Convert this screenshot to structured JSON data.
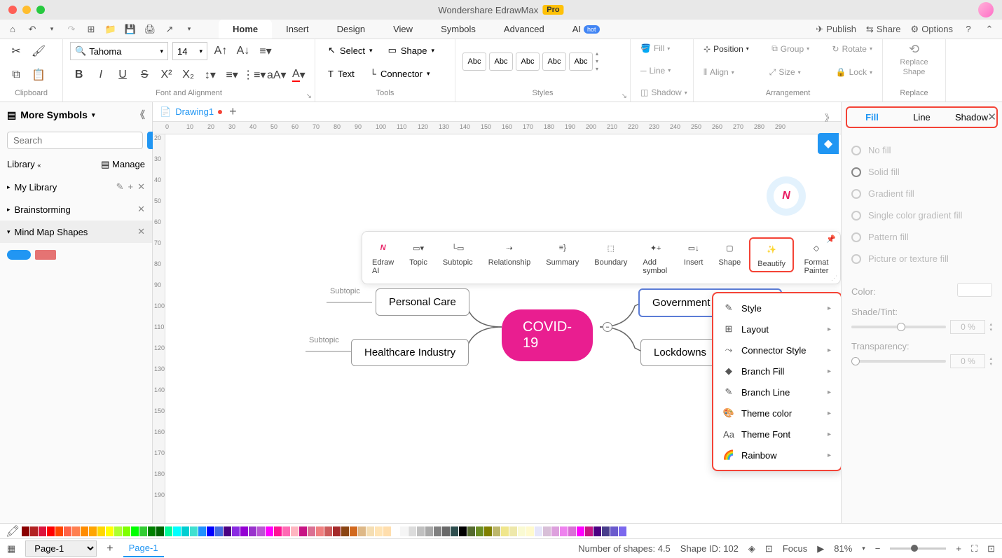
{
  "titlebar": {
    "app_name": "Wondershare EdrawMax",
    "pro": "Pro"
  },
  "menubar": {
    "tabs": [
      "Home",
      "Insert",
      "Design",
      "View",
      "Symbols",
      "Advanced"
    ],
    "ai_label": "AI",
    "hot": "hot",
    "right": {
      "publish": "Publish",
      "share": "Share",
      "options": "Options"
    }
  },
  "ribbon": {
    "clipboard": "Clipboard",
    "font": {
      "name": "Tahoma",
      "size": "14",
      "group_label": "Font and Alignment"
    },
    "tools": {
      "select": "Select",
      "shape": "Shape",
      "text": "Text",
      "connector": "Connector",
      "group_label": "Tools"
    },
    "styles": {
      "swatch_label": "Abc",
      "group_label": "Styles"
    },
    "style_dropdowns": {
      "fill": "Fill",
      "line": "Line",
      "shadow": "Shadow"
    },
    "arrangement": {
      "position": "Position",
      "align": "Align",
      "group": "Group",
      "size": "Size",
      "rotate": "Rotate",
      "lock": "Lock",
      "group_label": "Arrangement"
    },
    "replace": {
      "label1": "Replace",
      "label2": "Shape",
      "group_label": "Replace"
    }
  },
  "sidebar": {
    "title": "More Symbols",
    "search_placeholder": "Search",
    "search_btn": "Search",
    "library": "Library",
    "manage": "Manage",
    "items": [
      {
        "label": "My Library"
      },
      {
        "label": "Brainstorming"
      },
      {
        "label": "Mind Map Shapes"
      }
    ]
  },
  "doc": {
    "name": "Drawing1",
    "page_name": "Page-1"
  },
  "floating": {
    "items": [
      {
        "label": "Edraw AI"
      },
      {
        "label": "Topic"
      },
      {
        "label": "Subtopic"
      },
      {
        "label": "Relationship"
      },
      {
        "label": "Summary"
      },
      {
        "label": "Boundary"
      },
      {
        "label": "Add symbol"
      },
      {
        "label": "Insert"
      },
      {
        "label": "Shape"
      },
      {
        "label": "Beautify"
      },
      {
        "label": "Format Painter"
      }
    ]
  },
  "mindmap": {
    "center": "COVID-19",
    "nodes": {
      "tl": "Personal Care",
      "bl": "Healthcare Industry",
      "tr": "Government Restrictions",
      "br": "Lockdowns"
    },
    "subtopic_label": "Subtopic"
  },
  "context_menu": {
    "items": [
      {
        "label": "Style"
      },
      {
        "label": "Layout"
      },
      {
        "label": "Connector Style"
      },
      {
        "label": "Branch Fill"
      },
      {
        "label": "Branch Line"
      },
      {
        "label": "Theme color"
      },
      {
        "label": "Theme Font"
      },
      {
        "label": "Rainbow"
      }
    ]
  },
  "right_panel": {
    "tabs": {
      "fill": "Fill",
      "line": "Line",
      "shadow": "Shadow"
    },
    "fill_options": [
      "No fill",
      "Solid fill",
      "Gradient fill",
      "Single color gradient fill",
      "Pattern fill",
      "Picture or texture fill"
    ],
    "color_label": "Color:",
    "shade_label": "Shade/Tint:",
    "transparency_label": "Transparency:",
    "pct0": "0 %"
  },
  "statusbar": {
    "shapes": "Number of shapes: 4.5",
    "shape_id": "Shape ID: 102",
    "focus": "Focus",
    "zoom": "81%"
  },
  "ruler_h": [
    0,
    10,
    20,
    30,
    40,
    50,
    60,
    70,
    80,
    90,
    100,
    110,
    120,
    130,
    140,
    150,
    160,
    170,
    180,
    190,
    200,
    210,
    220,
    230,
    240,
    250,
    260,
    270,
    280,
    290
  ],
  "ruler_v": [
    20,
    30,
    40,
    50,
    60,
    70,
    80,
    90,
    100,
    110,
    120,
    130,
    140,
    150,
    160,
    170,
    180,
    190
  ]
}
